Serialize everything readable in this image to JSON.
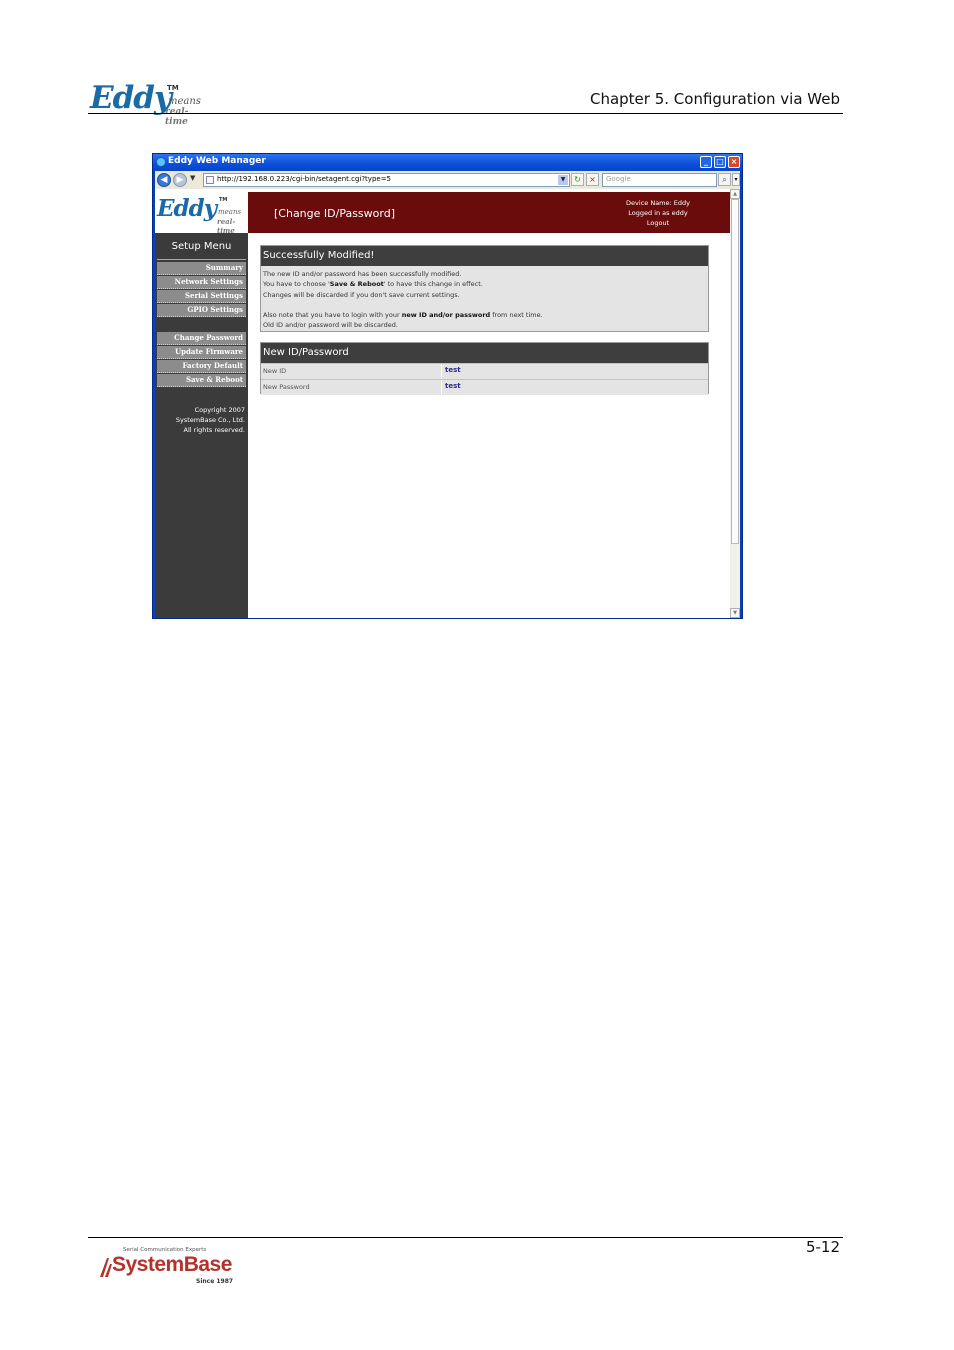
{
  "header": {
    "logo_text": "Eddy",
    "logo_tm": "TM",
    "logo_means": "means",
    "logo_realtime": "real-time",
    "chapter": "Chapter 5. Configuration via Web"
  },
  "browser": {
    "title": "Eddy Web Manager",
    "url": "http://192.168.0.223/cgi-bin/setagent.cgi?type=5",
    "search_placeholder": "Google"
  },
  "sidebar": {
    "setup_menu": "Setup Menu",
    "items": [
      {
        "label": "Summary"
      },
      {
        "label": "Network Settings"
      },
      {
        "label": "Serial Settings"
      },
      {
        "label": "GPIO Settings"
      },
      {
        "label": "Change Password"
      },
      {
        "label": "Update Firmware"
      },
      {
        "label": "Factory Default"
      },
      {
        "label": "Save & Reboot"
      }
    ],
    "copyright": [
      "Copyright 2007",
      "SystemBase Co., Ltd.",
      "All rights reserved."
    ]
  },
  "banner": {
    "title": "[Change ID/Password]",
    "device_name": "Device Name: Eddy",
    "logged_in": "Logged in as eddy",
    "logout": "Logout"
  },
  "success_panel": {
    "heading": "Successfully Modified!",
    "line1": "The new ID and/or password has been successfully modified.",
    "line2_pre": "You have to choose '",
    "line2_bold": "Save & Reboot",
    "line2_post": "' to have this change in effect.",
    "line3": "Changes will be discarded if you don't save current settings.",
    "line4_pre": "Also note that you have to login with your ",
    "line4_bold": "new ID and/or password",
    "line4_post": " from next time.",
    "line5": "Old ID and/or password will be discarded."
  },
  "id_panel": {
    "heading": "New ID/Password",
    "rows": [
      {
        "label": "New ID",
        "value": "test"
      },
      {
        "label": "New Password",
        "value": "test"
      }
    ]
  },
  "footer": {
    "page_number": "5-12",
    "tagline": "Serial Communication Experts",
    "brand": "SystemBase",
    "since": "Since 1987"
  },
  "colors": {
    "banner": "#6b0c0c",
    "sidebar": "#3b3b3b",
    "panel_head": "#3e3e3e",
    "eddy_blue": "#1b6aa8",
    "systembase_red": "#b4322b"
  }
}
